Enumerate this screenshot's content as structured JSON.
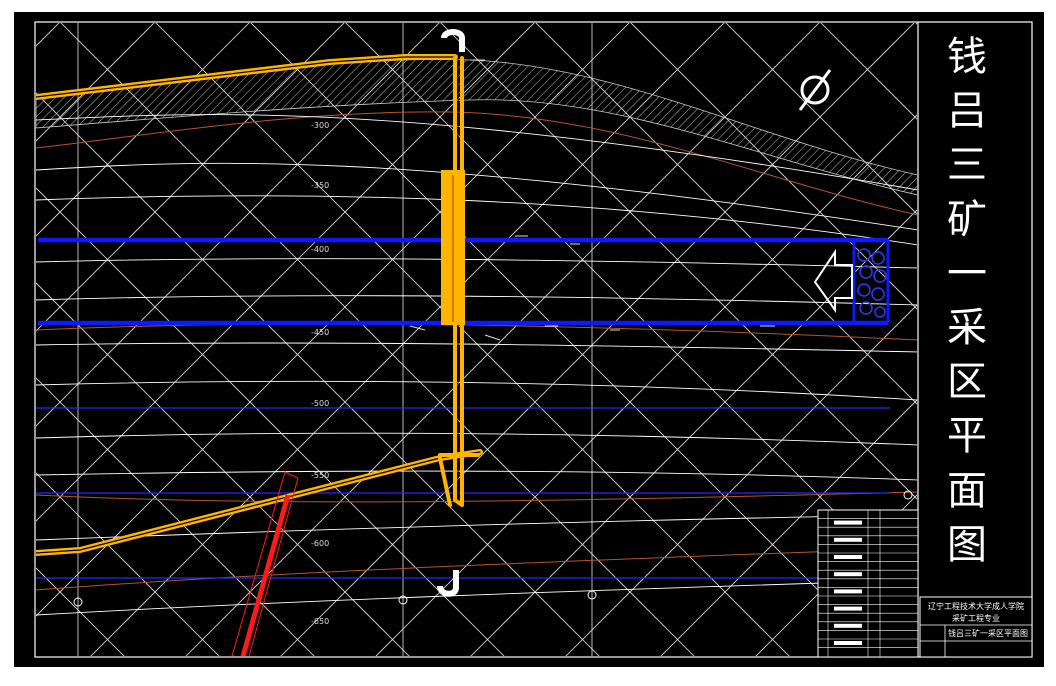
{
  "drawing": {
    "title_chars": [
      "钱",
      "吕",
      "三",
      "矿",
      "一",
      "采",
      "区",
      "平",
      "面",
      "图"
    ],
    "title_full": "钱吕三矿一采区平面图",
    "title_block": {
      "school": "辽宁工程技术大学成人学院",
      "major": "采矿工程专业",
      "drawing_name": "钱吕三矿一采区平面图"
    }
  },
  "contours": {
    "labels": [
      "-300",
      "-350",
      "-400",
      "-450",
      "-500",
      "-550",
      "-600",
      "-650"
    ]
  },
  "colors": {
    "background": "#000000",
    "frame": "#ffffff",
    "roadway_yellow": "#ffb400",
    "roadway_blue": "#0a1bff",
    "fault_red": "#ff1a1a",
    "contour_brown": "#b4552a",
    "grid_white": "#e6e6e6"
  },
  "icons": [
    "north-arrow-icon",
    "arrow-left-icon"
  ]
}
